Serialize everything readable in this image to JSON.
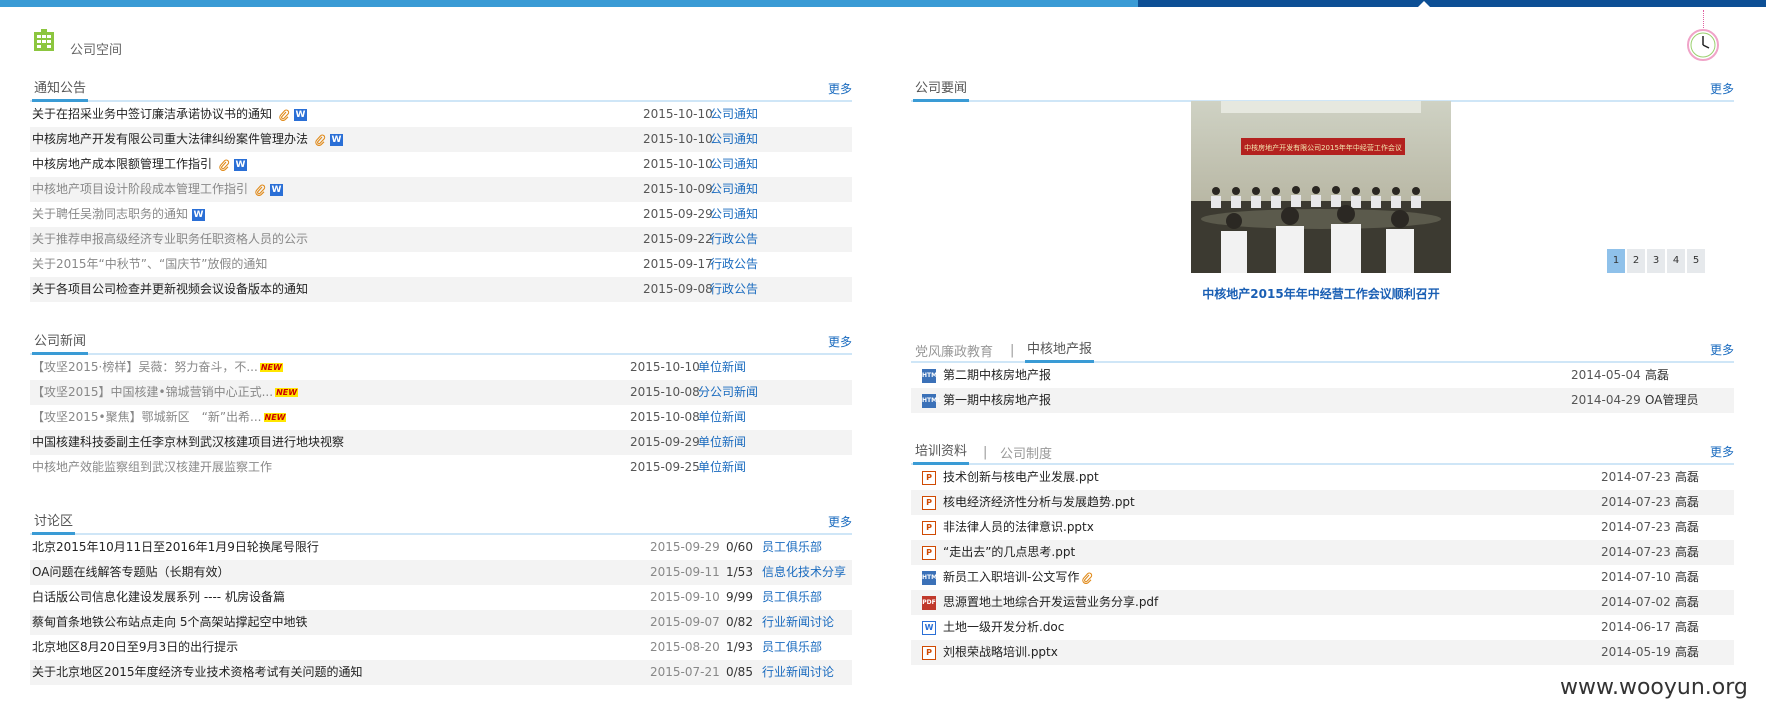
{
  "header": {
    "space_title": "公司空间"
  },
  "notices": {
    "title": "通知公告",
    "more": "更多",
    "rows": [
      {
        "title": "关于在招采业务中签订廉洁承诺协议书的通知",
        "date": "2015-10-10",
        "cat": "公司通知",
        "clip": true,
        "word": true,
        "gray": false
      },
      {
        "title": "中核房地产开发有限公司重大法律纠纷案件管理办法",
        "date": "2015-10-10",
        "cat": "公司通知",
        "clip": true,
        "word": true,
        "gray": false
      },
      {
        "title": "中核房地产成本限额管理工作指引",
        "date": "2015-10-10",
        "cat": "公司通知",
        "clip": true,
        "word": true,
        "gray": false
      },
      {
        "title": "中核地产项目设计阶段成本管理工作指引",
        "date": "2015-10-09",
        "cat": "公司通知",
        "clip": true,
        "word": true,
        "gray": true
      },
      {
        "title": "关于聘任吴渤同志职务的通知",
        "date": "2015-09-29",
        "cat": "公司通知",
        "clip": false,
        "word": true,
        "gray": true
      },
      {
        "title": "关于推荐申报高级经济专业职务任职资格人员的公示",
        "date": "2015-09-22",
        "cat": "行政公告",
        "clip": false,
        "word": false,
        "gray": true
      },
      {
        "title": "关于2015年“中秋节”、“国庆节”放假的通知",
        "date": "2015-09-17",
        "cat": "行政公告",
        "clip": false,
        "word": false,
        "gray": true
      },
      {
        "title": "关于各项目公司检查并更新视频会议设备版本的通知",
        "date": "2015-09-08",
        "cat": "行政公告",
        "clip": false,
        "word": false,
        "gray": false
      }
    ]
  },
  "news": {
    "title": "公司新闻",
    "more": "更多",
    "new_label": "NEW",
    "rows": [
      {
        "title": "【攻坚2015·榜样】吴薇：努力奋斗，不...",
        "date": "2015-10-10",
        "cat": "单位新闻",
        "is_new": true,
        "gray": true
      },
      {
        "title": "【攻坚2015】中国核建•锦城营销中心正式...",
        "date": "2015-10-08",
        "cat": "分公司新闻",
        "is_new": true,
        "gray": true
      },
      {
        "title": "【攻坚2015•聚焦】鄂城新区　“新”出希...",
        "date": "2015-10-08",
        "cat": "单位新闻",
        "is_new": true,
        "gray": true
      },
      {
        "title": "中国核建科技委副主任李京林到武汉核建项目进行地块视察",
        "date": "2015-09-29",
        "cat": "单位新闻",
        "is_new": false,
        "gray": false
      },
      {
        "title": "中核地产效能监察组到武汉核建开展监察工作",
        "date": "2015-09-25",
        "cat": "单位新闻",
        "is_new": false,
        "gray": true
      }
    ]
  },
  "discussion": {
    "title": "讨论区",
    "more": "更多",
    "rows": [
      {
        "title": "北京2015年10月11日至2016年1月9日轮换尾号限行",
        "date": "2015-09-29",
        "count": "0/60",
        "cat": "员工俱乐部"
      },
      {
        "title": "OA问题在线解答专题贴（长期有效）",
        "date": "2015-09-11",
        "count": "1/53",
        "cat": "信息化技术分享"
      },
      {
        "title": "白话版公司信息化建设发展系列 ---- 机房设备篇",
        "date": "2015-09-10",
        "count": "9/99",
        "cat": "员工俱乐部"
      },
      {
        "title": "蔡甸首条地铁公布站点走向 5个高架站撑起空中地铁",
        "date": "2015-09-07",
        "count": "0/82",
        "cat": "行业新闻讨论"
      },
      {
        "title": "北京地区8月20日至9月3日的出行提示",
        "date": "2015-08-20",
        "count": "1/93",
        "cat": "员工俱乐部"
      },
      {
        "title": "关于北京地区2015年度经济专业技术资格考试有关问题的通知",
        "date": "2015-07-21",
        "count": "0/85",
        "cat": "行业新闻讨论"
      }
    ]
  },
  "headlines": {
    "title": "公司要闻",
    "more": "更多",
    "photo_banner": "中核房地产开发有限公司2015年年中经营工作会议",
    "caption": "中核地产2015年年中经营工作会议顺利召开",
    "pages": [
      "1",
      "2",
      "3",
      "4",
      "5"
    ]
  },
  "party": {
    "tab_inactive": "党风廉政教育",
    "tab_active": "中核地产报",
    "separator": "|",
    "more": "更多",
    "rows": [
      {
        "title": "第二期中核房地产报",
        "date": "2014-05-04",
        "author": "高磊",
        "icon": "HTML"
      },
      {
        "title": "第一期中核房地产报",
        "date": "2014-04-29",
        "author": "OA管理员",
        "icon": "HTML"
      }
    ]
  },
  "training": {
    "tab_active": "培训资料",
    "tab_inactive": "公司制度",
    "separator": "|",
    "more": "更多",
    "rows": [
      {
        "title": "技术创新与核电产业发展.ppt",
        "date": "2014-07-23",
        "author": "高磊",
        "icon": "P"
      },
      {
        "title": "核电经济经济性分析与发展趋势.ppt",
        "date": "2014-07-23",
        "author": "高磊",
        "icon": "P"
      },
      {
        "title": "非法律人员的法律意识.pptx",
        "date": "2014-07-23",
        "author": "高磊",
        "icon": "P"
      },
      {
        "title": "“走出去”的几点思考.ppt",
        "date": "2014-07-23",
        "author": "高磊",
        "icon": "P"
      },
      {
        "title": "新员工入职培训-公文写作",
        "date": "2014-07-10",
        "author": "高磊",
        "icon": "HTML",
        "clip": true
      },
      {
        "title": "思源置地土地综合开发运营业务分享.pdf",
        "date": "2014-07-02",
        "author": "高磊",
        "icon": "PDF"
      },
      {
        "title": "土地一级开发分析.doc",
        "date": "2014-06-17",
        "author": "高磊",
        "icon": "W"
      },
      {
        "title": "刘根荣战略培训.pptx",
        "date": "2014-05-19",
        "author": "高磊",
        "icon": "P"
      }
    ]
  },
  "watermark": "www.wooyun.org"
}
